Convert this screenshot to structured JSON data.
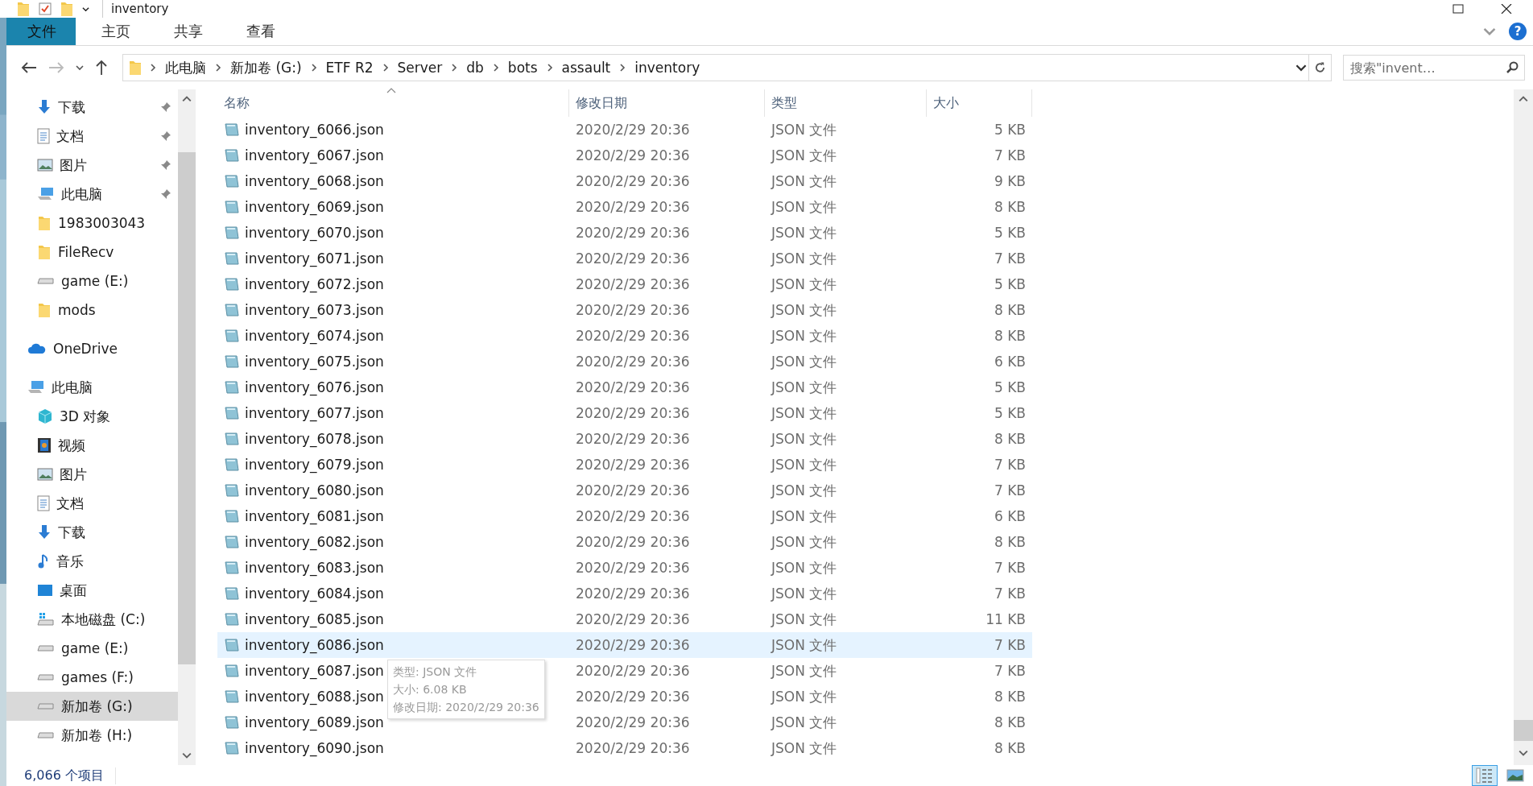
{
  "window": {
    "title": "inventory"
  },
  "ribbon": {
    "tabs": [
      {
        "label": "文件",
        "selected": true
      },
      {
        "label": "主页",
        "selected": false
      },
      {
        "label": "共享",
        "selected": false
      },
      {
        "label": "查看",
        "selected": false
      }
    ],
    "help": "?"
  },
  "address_bar": {
    "path": [
      "此电脑",
      "新加卷 (G:)",
      "ETF R2",
      "Server",
      "db",
      "bots",
      "assault",
      "inventory"
    ],
    "search_placeholder": "搜索\"invent…"
  },
  "navigation": {
    "quick_access": [
      {
        "label": "下载",
        "kind": "download",
        "pinned": true,
        "selected": false
      },
      {
        "label": "文档",
        "kind": "document",
        "pinned": true,
        "selected": false
      },
      {
        "label": "图片",
        "kind": "pictures",
        "pinned": true,
        "selected": false
      },
      {
        "label": "此电脑",
        "kind": "computer",
        "pinned": true,
        "selected": false
      },
      {
        "label": "1983003043",
        "kind": "folder",
        "pinned": false,
        "selected": false
      },
      {
        "label": "FileRecv",
        "kind": "folder",
        "pinned": false,
        "selected": false
      },
      {
        "label": "game (E:)",
        "kind": "drive",
        "pinned": false,
        "selected": false
      },
      {
        "label": "mods",
        "kind": "folder",
        "pinned": false,
        "selected": false
      }
    ],
    "roots": [
      {
        "label": "OneDrive",
        "kind": "onedrive",
        "selected": false
      },
      {
        "label": "此电脑",
        "kind": "computer",
        "selected": false,
        "children": [
          {
            "label": "3D 对象",
            "kind": "objects",
            "selected": false
          },
          {
            "label": "视频",
            "kind": "video",
            "selected": false
          },
          {
            "label": "图片",
            "kind": "pictures",
            "selected": false
          },
          {
            "label": "文档",
            "kind": "document",
            "selected": false
          },
          {
            "label": "下载",
            "kind": "download",
            "selected": false
          },
          {
            "label": "音乐",
            "kind": "music",
            "selected": false
          },
          {
            "label": "桌面",
            "kind": "desktop",
            "selected": false
          },
          {
            "label": "本地磁盘 (C:)",
            "kind": "system-drive",
            "selected": false
          },
          {
            "label": "game (E:)",
            "kind": "drive",
            "selected": false
          },
          {
            "label": "games (F:)",
            "kind": "drive",
            "selected": false
          },
          {
            "label": "新加卷 (G:)",
            "kind": "drive",
            "selected": true
          },
          {
            "label": "新加卷 (H:)",
            "kind": "drive",
            "selected": false
          }
        ]
      }
    ]
  },
  "columns": [
    "名称",
    "修改日期",
    "类型",
    "大小"
  ],
  "files": [
    {
      "name": "inventory_6066.json",
      "modified": "2020/2/29 20:36",
      "type": "JSON 文件",
      "size": "5 KB",
      "selected": false
    },
    {
      "name": "inventory_6067.json",
      "modified": "2020/2/29 20:36",
      "type": "JSON 文件",
      "size": "7 KB",
      "selected": false
    },
    {
      "name": "inventory_6068.json",
      "modified": "2020/2/29 20:36",
      "type": "JSON 文件",
      "size": "9 KB",
      "selected": false
    },
    {
      "name": "inventory_6069.json",
      "modified": "2020/2/29 20:36",
      "type": "JSON 文件",
      "size": "8 KB",
      "selected": false
    },
    {
      "name": "inventory_6070.json",
      "modified": "2020/2/29 20:36",
      "type": "JSON 文件",
      "size": "5 KB",
      "selected": false
    },
    {
      "name": "inventory_6071.json",
      "modified": "2020/2/29 20:36",
      "type": "JSON 文件",
      "size": "7 KB",
      "selected": false
    },
    {
      "name": "inventory_6072.json",
      "modified": "2020/2/29 20:36",
      "type": "JSON 文件",
      "size": "5 KB",
      "selected": false
    },
    {
      "name": "inventory_6073.json",
      "modified": "2020/2/29 20:36",
      "type": "JSON 文件",
      "size": "8 KB",
      "selected": false
    },
    {
      "name": "inventory_6074.json",
      "modified": "2020/2/29 20:36",
      "type": "JSON 文件",
      "size": "8 KB",
      "selected": false
    },
    {
      "name": "inventory_6075.json",
      "modified": "2020/2/29 20:36",
      "type": "JSON 文件",
      "size": "6 KB",
      "selected": false
    },
    {
      "name": "inventory_6076.json",
      "modified": "2020/2/29 20:36",
      "type": "JSON 文件",
      "size": "5 KB",
      "selected": false
    },
    {
      "name": "inventory_6077.json",
      "modified": "2020/2/29 20:36",
      "type": "JSON 文件",
      "size": "5 KB",
      "selected": false
    },
    {
      "name": "inventory_6078.json",
      "modified": "2020/2/29 20:36",
      "type": "JSON 文件",
      "size": "8 KB",
      "selected": false
    },
    {
      "name": "inventory_6079.json",
      "modified": "2020/2/29 20:36",
      "type": "JSON 文件",
      "size": "7 KB",
      "selected": false
    },
    {
      "name": "inventory_6080.json",
      "modified": "2020/2/29 20:36",
      "type": "JSON 文件",
      "size": "7 KB",
      "selected": false
    },
    {
      "name": "inventory_6081.json",
      "modified": "2020/2/29 20:36",
      "type": "JSON 文件",
      "size": "6 KB",
      "selected": false
    },
    {
      "name": "inventory_6082.json",
      "modified": "2020/2/29 20:36",
      "type": "JSON 文件",
      "size": "8 KB",
      "selected": false
    },
    {
      "name": "inventory_6083.json",
      "modified": "2020/2/29 20:36",
      "type": "JSON 文件",
      "size": "7 KB",
      "selected": false
    },
    {
      "name": "inventory_6084.json",
      "modified": "2020/2/29 20:36",
      "type": "JSON 文件",
      "size": "7 KB",
      "selected": false
    },
    {
      "name": "inventory_6085.json",
      "modified": "2020/2/29 20:36",
      "type": "JSON 文件",
      "size": "11 KB",
      "selected": false
    },
    {
      "name": "inventory_6086.json",
      "modified": "2020/2/29 20:36",
      "type": "JSON 文件",
      "size": "7 KB",
      "selected": true
    },
    {
      "name": "inventory_6087.json",
      "modified": "2020/2/29 20:36",
      "type": "JSON 文件",
      "size": "7 KB",
      "selected": false
    },
    {
      "name": "inventory_6088.json",
      "modified": "2020/2/29 20:36",
      "type": "JSON 文件",
      "size": "8 KB",
      "selected": false
    },
    {
      "name": "inventory_6089.json",
      "modified": "2020/2/29 20:36",
      "type": "JSON 文件",
      "size": "8 KB",
      "selected": false
    },
    {
      "name": "inventory_6090.json",
      "modified": "2020/2/29 20:36",
      "type": "JSON 文件",
      "size": "8 KB",
      "selected": false
    }
  ],
  "tooltip": [
    "类型: JSON 文件",
    "大小: 6.08 KB",
    "修改日期: 2020/2/29 20:36"
  ],
  "status_bar": {
    "item_count": "6,066 个项目",
    "views": [
      {
        "kind": "details",
        "selected": true
      },
      {
        "kind": "large-icons",
        "selected": false
      }
    ]
  }
}
